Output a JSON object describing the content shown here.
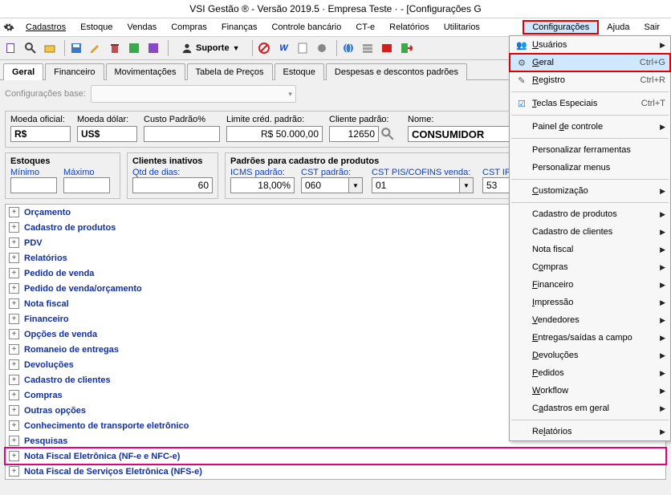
{
  "title": "VSI Gestão ®  -  Versão 2019.5 · Empresa Teste ·  -  [Configurações G",
  "menubar": {
    "items": [
      "Cadastros",
      "Estoque",
      "Vendas",
      "Compras",
      "Finanças",
      "Controle bancário",
      "CT-e",
      "Relatórios",
      "Utilitarios"
    ],
    "config": "Configurações",
    "ajuda": "Ajuda",
    "sair": "Sair"
  },
  "toolbar": {
    "suporte": "Suporte"
  },
  "tabs": [
    "Geral",
    "Financeiro",
    "Movimentações",
    "Tabela de Preços",
    "Estoque",
    "Despesas e descontos padrões"
  ],
  "base": {
    "label": "Configurações base:"
  },
  "fields_top": {
    "moeda_oficial_lbl": "Moeda oficial:",
    "moeda_oficial_val": "R$",
    "moeda_dolar_lbl": "Moeda dólar:",
    "moeda_dolar_val": "US$",
    "custo_lbl": "Custo Padrão%",
    "custo_val": "",
    "limite_lbl": "Limite créd. padrão:",
    "limite_val": "R$ 50.000,00",
    "cliente_lbl": "Cliente padrão:",
    "cliente_val": "12650",
    "nome_lbl": "Nome:",
    "nome_val": "CONSUMIDOR"
  },
  "estoques": {
    "title": "Estoques",
    "min_lbl": "Mínimo",
    "min_val": "",
    "max_lbl": "Máximo",
    "max_val": ""
  },
  "clientes_inativos": {
    "title": "Clientes inativos",
    "dias_lbl": "Qtd de dias:",
    "dias_val": "60"
  },
  "padroes": {
    "title": "Padrões para cadastro de produtos",
    "icms_lbl": "ICMS padrão:",
    "icms_val": "18,00%",
    "cst_lbl": "CST padrão:",
    "cst_val": "060",
    "pis_lbl": "CST PIS/COFINS venda:",
    "pis_val": "01",
    "ipi_lbl": "CST IPI:",
    "ipi_val": "53"
  },
  "tree": [
    "Orçamento",
    "Cadastro de produtos",
    "PDV",
    "Relatórios",
    "Pedido de venda",
    "Pedido de venda/orçamento",
    "Nota fiscal",
    "Financeiro",
    "Opções de venda",
    "Romaneio de entregas",
    "Devoluções",
    "Cadastro de clientes",
    "Compras",
    "Outras opções",
    "Conhecimento de transporte eletrônico",
    "Pesquisas",
    "Nota Fiscal Eletrônica (NF-e e NFC-e)",
    "Nota Fiscal de Serviços Eletrônica (NFS-e)"
  ],
  "dropdown": {
    "usuarios": "Usuários",
    "geral": "Geral",
    "geral_sc": "Ctrl+G",
    "registro": "Registro",
    "registro_sc": "Ctrl+R",
    "teclas": "Teclas Especiais",
    "teclas_sc": "Ctrl+T",
    "painel": "Painel de controle",
    "person_ferr": "Personalizar ferramentas",
    "person_menu": "Personalizar menus",
    "custom": "Customização",
    "cad_prod": "Cadastro de produtos",
    "cad_cli": "Cadastro de clientes",
    "nota": "Nota fiscal",
    "compras": "Compras",
    "financeiro": "Financeiro",
    "impressao": "Impressão",
    "vendedores": "Vendedores",
    "entregas": "Entregas/saídas a campo",
    "devolucoes": "Devoluções",
    "pedidos": "Pedidos",
    "workflow": "Workflow",
    "cad_geral": "Cadastros em geral",
    "relatorios": "Relatórios"
  }
}
